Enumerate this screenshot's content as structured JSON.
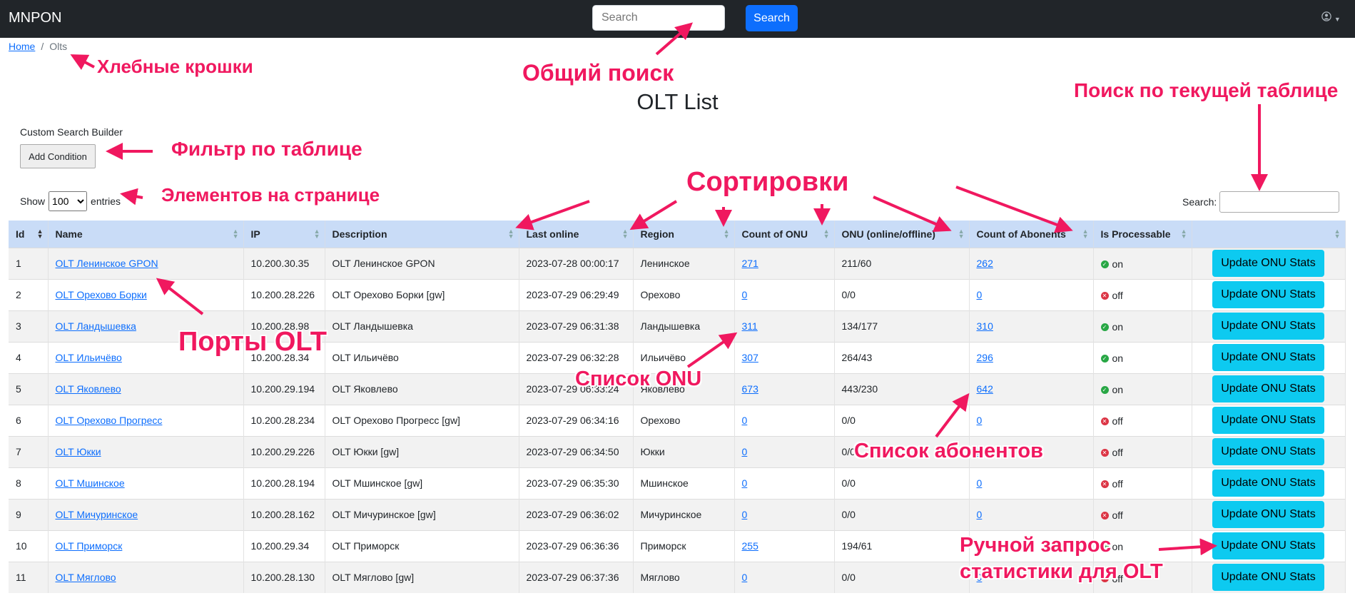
{
  "app": {
    "brand": "MNPON"
  },
  "header": {
    "search_placeholder": "Search",
    "search_button": "Search",
    "user_icon": "user-circle-icon"
  },
  "breadcrumb": {
    "home": "Home",
    "separator": "/",
    "current": "Olts"
  },
  "page": {
    "title": "OLT List"
  },
  "filter": {
    "title": "Custom Search Builder",
    "add_condition": "Add Condition"
  },
  "length": {
    "show": "Show",
    "value": "100",
    "entries": "entries"
  },
  "table_search": {
    "label": "Search:"
  },
  "table": {
    "columns": [
      "Id",
      "Name",
      "IP",
      "Description",
      "Last online",
      "Region",
      "Count of ONU",
      "ONU (online/offline)",
      "Count of Abonents",
      "Is Processable",
      ""
    ],
    "rows": [
      {
        "id": "1",
        "name": "OLT Ленинское GPON",
        "ip": "10.200.30.35",
        "description": "OLT Ленинское GPON",
        "last_online": "2023-07-28 00:00:17",
        "region": "Ленинское",
        "onu": "271",
        "onu_status": "211/60",
        "abonents": "262",
        "processable": "on"
      },
      {
        "id": "2",
        "name": "OLT Орехово Борки",
        "ip": "10.200.28.226",
        "description": "OLT Орехово Борки [gw]",
        "last_online": "2023-07-29 06:29:49",
        "region": "Орехово",
        "onu": "0",
        "onu_status": "0/0",
        "abonents": "0",
        "processable": "off"
      },
      {
        "id": "3",
        "name": "OLT Ландышевка",
        "ip": "10.200.28.98",
        "description": "OLT Ландышевка",
        "last_online": "2023-07-29 06:31:38",
        "region": "Ландышевка",
        "onu": "311",
        "onu_status": "134/177",
        "abonents": "310",
        "processable": "on"
      },
      {
        "id": "4",
        "name": "OLT Ильичёво",
        "ip": "10.200.28.34",
        "description": "OLT Ильичёво",
        "last_online": "2023-07-29 06:32:28",
        "region": "Ильичёво",
        "onu": "307",
        "onu_status": "264/43",
        "abonents": "296",
        "processable": "on"
      },
      {
        "id": "5",
        "name": "OLT Яковлево",
        "ip": "10.200.29.194",
        "description": "OLT Яковлево",
        "last_online": "2023-07-29 06:33:24",
        "region": "Яковлево",
        "onu": "673",
        "onu_status": "443/230",
        "abonents": "642",
        "processable": "on"
      },
      {
        "id": "6",
        "name": "OLT Орехово Прогресс",
        "ip": "10.200.28.234",
        "description": "OLT Орехово Прогресс [gw]",
        "last_online": "2023-07-29 06:34:16",
        "region": "Орехово",
        "onu": "0",
        "onu_status": "0/0",
        "abonents": "0",
        "processable": "off"
      },
      {
        "id": "7",
        "name": "OLT Юкки",
        "ip": "10.200.29.226",
        "description": "OLT Юкки [gw]",
        "last_online": "2023-07-29 06:34:50",
        "region": "Юкки",
        "onu": "0",
        "onu_status": "0/0",
        "abonents": "0",
        "processable": "off"
      },
      {
        "id": "8",
        "name": "OLT Мшинское",
        "ip": "10.200.28.194",
        "description": "OLT Мшинское [gw]",
        "last_online": "2023-07-29 06:35:30",
        "region": "Мшинское",
        "onu": "0",
        "onu_status": "0/0",
        "abonents": "0",
        "processable": "off"
      },
      {
        "id": "9",
        "name": "OLT Мичуринское",
        "ip": "10.200.28.162",
        "description": "OLT Мичуринское [gw]",
        "last_online": "2023-07-29 06:36:02",
        "region": "Мичуринское",
        "onu": "0",
        "onu_status": "0/0",
        "abonents": "0",
        "processable": "off"
      },
      {
        "id": "10",
        "name": "OLT Приморск",
        "ip": "10.200.29.34",
        "description": "OLT Приморск",
        "last_online": "2023-07-29 06:36:36",
        "region": "Приморск",
        "onu": "255",
        "onu_status": "194/61",
        "abonents": "",
        "processable": "on"
      },
      {
        "id": "11",
        "name": "OLT Мяглово",
        "ip": "10.200.28.130",
        "description": "OLT Мяглово [gw]",
        "last_online": "2023-07-29 06:37:36",
        "region": "Мяглово",
        "onu": "0",
        "onu_status": "0/0",
        "abonents": "0",
        "processable": "off"
      }
    ],
    "update_label": "Update ONU Stats"
  },
  "annotations": {
    "breadcrumbs": "Хлебные крошки",
    "global_search": "Общий поиск",
    "table_search": "Поиск по текущей таблице",
    "filter": "Фильтр по таблице",
    "page_size": "Элементов на странице",
    "sorting": "Сортировки",
    "ports": "Порты OLT",
    "onu_list": "Список ONU",
    "abonents_list": "Список абонентов",
    "manual_stats": "Ручной запрос\nстатистики для OLT"
  },
  "colors": {
    "navbar": "#212529",
    "primary": "#0d6efd",
    "info": "#0dcaf0",
    "header_bg": "#c9dcf7",
    "annotation": "#f0185f"
  }
}
